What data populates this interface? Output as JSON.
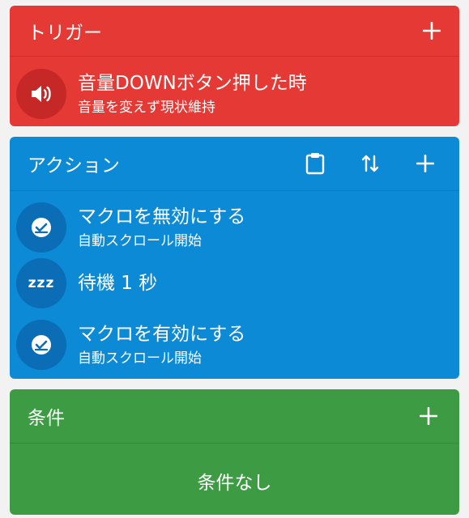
{
  "trigger": {
    "header": "トリガー",
    "color": "#e53935",
    "items": [
      {
        "title": "音量DOWNボタン押した時",
        "subtitle": "音量を変えず現状維持",
        "icon": "volume-icon"
      }
    ]
  },
  "actions": {
    "header": "アクション",
    "color": "#0d8ad6",
    "header_icons": [
      "clipboard-icon",
      "reorder-icon",
      "plus-icon"
    ],
    "items": [
      {
        "title": "マクロを無効にする",
        "subtitle": "自動スクロール開始",
        "icon": "macro-check-icon"
      },
      {
        "title": "待機 1 秒",
        "subtitle": "",
        "icon": "zzz-icon",
        "icon_text": "zzz"
      },
      {
        "title": "マクロを有効にする",
        "subtitle": "自動スクロール開始",
        "icon": "macro-check-icon"
      }
    ]
  },
  "constraints": {
    "header": "条件",
    "color": "#3d9c43",
    "empty_text": "条件なし"
  }
}
